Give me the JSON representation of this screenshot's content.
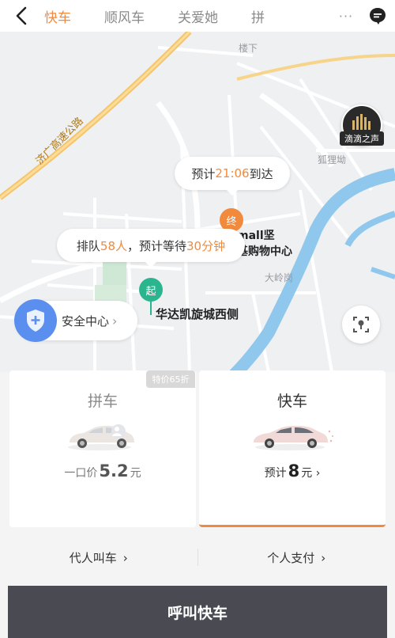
{
  "nav": {
    "tabs": [
      {
        "label": "快车",
        "active": true
      },
      {
        "label": "顺风车",
        "active": false
      },
      {
        "label": "关爱她",
        "active": false
      },
      {
        "label": "拼",
        "active": false
      }
    ],
    "more": "···",
    "icons": {
      "back": "back-arrow-icon",
      "message": "message-icon"
    }
  },
  "map": {
    "place_labels": {
      "a": "楼下",
      "b": "狐狸坳",
      "c": "大岭岗"
    },
    "road_label": "济广高速公路",
    "eta_bubble": {
      "prefix": "预计",
      "time": "21:06",
      "suffix": "到达"
    },
    "queue_bubble": {
      "p1": "排队",
      "count": "58人",
      "p2": "，预计等待",
      "wait": "30分钟"
    },
    "end_pin": "终",
    "end_poi_line1": "mall坚",
    "end_poi_line2": "基购物中心",
    "start_pin": "起",
    "start_poi": "华达凯旋城西侧",
    "safety": {
      "label": "安全中心",
      "chevron": "›"
    },
    "voice_label": "滴滴之声",
    "colors": {
      "road_major": "#f5c56a",
      "river": "#8fc8ec",
      "start": "#2bb58e",
      "end": "#f28a3e"
    }
  },
  "cards": {
    "discount_badge": "特价65折",
    "carpool": {
      "title": "拼车",
      "price_prefix": "一口价",
      "price": "5.2",
      "unit": "元"
    },
    "express": {
      "title": "快车",
      "price_prefix": "预计",
      "price": "8",
      "unit": "元",
      "chevron": "›"
    }
  },
  "options": {
    "proxy_call": "代人叫车",
    "personal_pay": "个人支付",
    "chevron": "›"
  },
  "call_button": "呼叫快车"
}
